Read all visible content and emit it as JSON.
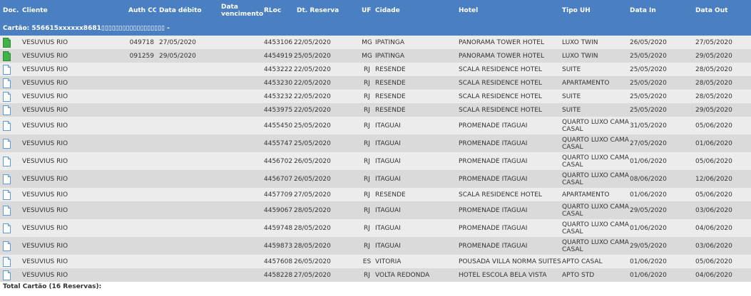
{
  "headers": {
    "doc": "Doc.",
    "cliente": "Cliente",
    "auth_cc": "Auth CC",
    "data_debito": "Data débito",
    "data_vencimento": "Data vencimento",
    "rloc": "RLoc",
    "dt_reserva": "Dt. Reserva",
    "uf": "UF",
    "cidade": "Cidade",
    "hotel": "Hotel",
    "tipo_uh": "Tipo UH",
    "data_in": "Data In",
    "data_out": "Data Out"
  },
  "card_label": "Cartão: 556615xxxxxx8681▯▯▯▯▯▯▯▯▯▯▯▯▯▯▯▯▯▯ -",
  "rows": [
    {
      "doc_icon": "green-document-icon",
      "cliente": "VESUVIUS RIO",
      "auth_cc": "049718",
      "data_debito": "27/05/2020",
      "data_vencimento": "",
      "rloc": "4453106",
      "dt_reserva": "22/05/2020",
      "uf": "MG",
      "cidade": "IPATINGA",
      "hotel": "PANORAMA TOWER HOTEL",
      "tipo_uh": "LUXO TWIN",
      "data_in": "26/05/2020",
      "data_out": "27/05/2020"
    },
    {
      "doc_icon": "green-document-icon",
      "cliente": "VESUVIUS RIO",
      "auth_cc": "091259",
      "data_debito": "29/05/2020",
      "data_vencimento": "",
      "rloc": "4454919",
      "dt_reserva": "25/05/2020",
      "uf": "MG",
      "cidade": "IPATINGA",
      "hotel": "PANORAMA TOWER HOTEL",
      "tipo_uh": "LUXO TWIN",
      "data_in": "25/05/2020",
      "data_out": "29/05/2020"
    },
    {
      "doc_icon": "blue-document-icon",
      "cliente": "VESUVIUS RIO",
      "auth_cc": "",
      "data_debito": "",
      "data_vencimento": "",
      "rloc": "4453222",
      "dt_reserva": "22/05/2020",
      "uf": "RJ",
      "cidade": "RESENDE",
      "hotel": "SCALA RESIDENCE HOTEL",
      "tipo_uh": "SUITE",
      "data_in": "25/05/2020",
      "data_out": "28/05/2020"
    },
    {
      "doc_icon": "blue-document-icon",
      "cliente": "VESUVIUS RIO",
      "auth_cc": "",
      "data_debito": "",
      "data_vencimento": "",
      "rloc": "4453230",
      "dt_reserva": "22/05/2020",
      "uf": "RJ",
      "cidade": "RESENDE",
      "hotel": "SCALA RESIDENCE HOTEL",
      "tipo_uh": "APARTAMENTO",
      "data_in": "25/05/2020",
      "data_out": "28/05/2020"
    },
    {
      "doc_icon": "blue-document-icon",
      "cliente": "VESUVIUS RIO",
      "auth_cc": "",
      "data_debito": "",
      "data_vencimento": "",
      "rloc": "4453232",
      "dt_reserva": "22/05/2020",
      "uf": "RJ",
      "cidade": "RESENDE",
      "hotel": "SCALA RESIDENCE HOTEL",
      "tipo_uh": "SUITE",
      "data_in": "25/05/2020",
      "data_out": "28/05/2020"
    },
    {
      "doc_icon": "blue-document-icon",
      "cliente": "VESUVIUS RIO",
      "auth_cc": "",
      "data_debito": "",
      "data_vencimento": "",
      "rloc": "4453975",
      "dt_reserva": "22/05/2020",
      "uf": "RJ",
      "cidade": "RESENDE",
      "hotel": "SCALA RESIDENCE HOTEL",
      "tipo_uh": "SUITE",
      "data_in": "25/05/2020",
      "data_out": "29/05/2020"
    },
    {
      "doc_icon": "blue-document-icon",
      "cliente": "VESUVIUS RIO",
      "auth_cc": "",
      "data_debito": "",
      "data_vencimento": "",
      "rloc": "4455450",
      "dt_reserva": "25/05/2020",
      "uf": "RJ",
      "cidade": "ITAGUAI",
      "hotel": "PROMENADE ITAGUAI",
      "tipo_uh": "QUARTO LUXO CAMA CASAL",
      "data_in": "31/05/2020",
      "data_out": "05/06/2020"
    },
    {
      "doc_icon": "blue-document-icon",
      "cliente": "VESUVIUS RIO",
      "auth_cc": "",
      "data_debito": "",
      "data_vencimento": "",
      "rloc": "4455747",
      "dt_reserva": "25/05/2020",
      "uf": "RJ",
      "cidade": "ITAGUAI",
      "hotel": "PROMENADE ITAGUAI",
      "tipo_uh": "QUARTO LUXO CAMA CASAL",
      "data_in": "27/05/2020",
      "data_out": "01/06/2020"
    },
    {
      "doc_icon": "blue-document-icon",
      "cliente": "VESUVIUS RIO",
      "auth_cc": "",
      "data_debito": "",
      "data_vencimento": "",
      "rloc": "4456702",
      "dt_reserva": "26/05/2020",
      "uf": "RJ",
      "cidade": "ITAGUAI",
      "hotel": "PROMENADE ITAGUAI",
      "tipo_uh": "QUARTO LUXO CAMA CASAL",
      "data_in": "01/06/2020",
      "data_out": "05/06/2020"
    },
    {
      "doc_icon": "blue-document-icon",
      "cliente": "VESUVIUS RIO",
      "auth_cc": "",
      "data_debito": "",
      "data_vencimento": "",
      "rloc": "4456707",
      "dt_reserva": "26/05/2020",
      "uf": "RJ",
      "cidade": "ITAGUAI",
      "hotel": "PROMENADE ITAGUAI",
      "tipo_uh": "QUARTO LUXO CAMA CASAL",
      "data_in": "08/06/2020",
      "data_out": "12/06/2020"
    },
    {
      "doc_icon": "blue-document-icon",
      "cliente": "VESUVIUS RIO",
      "auth_cc": "",
      "data_debito": "",
      "data_vencimento": "",
      "rloc": "4457709",
      "dt_reserva": "27/05/2020",
      "uf": "RJ",
      "cidade": "RESENDE",
      "hotel": "SCALA RESIDENCE HOTEL",
      "tipo_uh": "APARTAMENTO",
      "data_in": "01/06/2020",
      "data_out": "05/06/2020"
    },
    {
      "doc_icon": "blue-document-icon",
      "cliente": "VESUVIUS RIO",
      "auth_cc": "",
      "data_debito": "",
      "data_vencimento": "",
      "rloc": "4459067",
      "dt_reserva": "28/05/2020",
      "uf": "RJ",
      "cidade": "ITAGUAI",
      "hotel": "PROMENADE ITAGUAI",
      "tipo_uh": "QUARTO LUXO CAMA CASAL",
      "data_in": "29/05/2020",
      "data_out": "03/06/2020"
    },
    {
      "doc_icon": "blue-document-icon",
      "cliente": "VESUVIUS RIO",
      "auth_cc": "",
      "data_debito": "",
      "data_vencimento": "",
      "rloc": "4459748",
      "dt_reserva": "28/05/2020",
      "uf": "RJ",
      "cidade": "ITAGUAI",
      "hotel": "PROMENADE ITAGUAI",
      "tipo_uh": "QUARTO LUXO CAMA CASAL",
      "data_in": "01/06/2020",
      "data_out": "04/06/2020"
    },
    {
      "doc_icon": "blue-document-icon",
      "cliente": "VESUVIUS RIO",
      "auth_cc": "",
      "data_debito": "",
      "data_vencimento": "",
      "rloc": "4459873",
      "dt_reserva": "28/05/2020",
      "uf": "RJ",
      "cidade": "ITAGUAI",
      "hotel": "PROMENADE ITAGUAI",
      "tipo_uh": "QUARTO LUXO CAMA CASAL",
      "data_in": "29/05/2020",
      "data_out": "03/06/2020"
    },
    {
      "doc_icon": "blue-document-icon",
      "cliente": "VESUVIUS RIO",
      "auth_cc": "",
      "data_debito": "",
      "data_vencimento": "",
      "rloc": "4457608",
      "dt_reserva": "26/05/2020",
      "uf": "ES",
      "cidade": "VITORIA",
      "hotel": "POUSADA VILLA NORMA SUITES",
      "tipo_uh": "APTO CASAL",
      "data_in": "01/06/2020",
      "data_out": "05/06/2020"
    },
    {
      "doc_icon": "blue-document-icon",
      "cliente": "VESUVIUS RIO",
      "auth_cc": "",
      "data_debito": "",
      "data_vencimento": "",
      "rloc": "4458228",
      "dt_reserva": "27/05/2020",
      "uf": "RJ",
      "cidade": "VOLTA REDONDA",
      "hotel": "HOTEL ESCOLA BELA VISTA",
      "tipo_uh": "APTO STD",
      "data_in": "01/06/2020",
      "data_out": "04/06/2020"
    }
  ],
  "total_label": "Total Cartão (16 Reservas):",
  "colors": {
    "header_bg": "#4a7fc1",
    "row_odd": "#ececec",
    "row_even": "#dadada",
    "green_doc": "#3fb24a",
    "blue_doc": "#5b9bd5"
  }
}
